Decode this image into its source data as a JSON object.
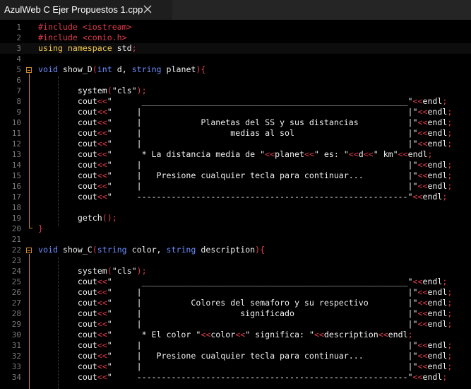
{
  "tab": {
    "title": "AzulWeb C Ejer Propuestos 1.cpp",
    "close_icon": "close-icon"
  },
  "lines": [
    {
      "n": "1",
      "tokens": [
        [
          "k-pp",
          "#include <iostream>"
        ]
      ]
    },
    {
      "n": "2",
      "tokens": [
        [
          "k-pp",
          "#include <conio.h>"
        ]
      ]
    },
    {
      "n": "3",
      "tokens": [
        [
          "k-kw",
          "using namespace"
        ],
        [
          "k-id",
          " std"
        ],
        [
          "k-op",
          ";"
        ]
      ]
    },
    {
      "n": "4",
      "tokens": []
    },
    {
      "n": "5",
      "tokens": [
        [
          "k-type",
          "void"
        ],
        [
          "k-id",
          " show_D"
        ],
        [
          "k-par",
          "("
        ],
        [
          "k-type",
          "int"
        ],
        [
          "k-id",
          " d, "
        ],
        [
          "k-type",
          "string"
        ],
        [
          "k-id",
          " planet"
        ],
        [
          "k-par",
          "){"
        ]
      ]
    },
    {
      "n": "6",
      "tokens": []
    },
    {
      "n": "7",
      "tokens": [
        [
          "k-id",
          "        system"
        ],
        [
          "k-par",
          "("
        ],
        [
          "k-str",
          "\"cls\""
        ],
        [
          "k-par",
          ")"
        ],
        [
          "k-op",
          ";"
        ]
      ]
    },
    {
      "n": "8",
      "tokens": [
        [
          "k-id",
          "        cout"
        ],
        [
          "k-op",
          "<<"
        ],
        [
          "k-str",
          "\"      ______________________________________________________\""
        ],
        [
          "k-op",
          "<<"
        ],
        [
          "k-id",
          "endl"
        ],
        [
          "k-op",
          ";"
        ]
      ]
    },
    {
      "n": "9",
      "tokens": [
        [
          "k-id",
          "        cout"
        ],
        [
          "k-op",
          "<<"
        ],
        [
          "k-str",
          "\"     |                                                      |\""
        ],
        [
          "k-op",
          "<<"
        ],
        [
          "k-id",
          "endl"
        ],
        [
          "k-op",
          ";"
        ]
      ]
    },
    {
      "n": "10",
      "tokens": [
        [
          "k-id",
          "        cout"
        ],
        [
          "k-op",
          "<<"
        ],
        [
          "k-str",
          "\"     |            Planetas del SS y sus distancias          |\""
        ],
        [
          "k-op",
          "<<"
        ],
        [
          "k-id",
          "endl"
        ],
        [
          "k-op",
          ";"
        ]
      ]
    },
    {
      "n": "11",
      "tokens": [
        [
          "k-id",
          "        cout"
        ],
        [
          "k-op",
          "<<"
        ],
        [
          "k-str",
          "\"     |                  medias al sol                       |\""
        ],
        [
          "k-op",
          "<<"
        ],
        [
          "k-id",
          "endl"
        ],
        [
          "k-op",
          ";"
        ]
      ]
    },
    {
      "n": "12",
      "tokens": [
        [
          "k-id",
          "        cout"
        ],
        [
          "k-op",
          "<<"
        ],
        [
          "k-str",
          "\"     |                                                      |\""
        ],
        [
          "k-op",
          "<<"
        ],
        [
          "k-id",
          "endl"
        ],
        [
          "k-op",
          ";"
        ]
      ]
    },
    {
      "n": "13",
      "tokens": [
        [
          "k-id",
          "        cout"
        ],
        [
          "k-op",
          "<<"
        ],
        [
          "k-str",
          "\"      * La distancia media de \""
        ],
        [
          "k-op",
          "<<"
        ],
        [
          "k-id",
          "planet"
        ],
        [
          "k-op",
          "<<"
        ],
        [
          "k-str",
          "\" es: \""
        ],
        [
          "k-op",
          "<<"
        ],
        [
          "k-id",
          "d"
        ],
        [
          "k-op",
          "<<"
        ],
        [
          "k-str",
          "\" km\""
        ],
        [
          "k-op",
          "<<"
        ],
        [
          "k-id",
          "endl"
        ],
        [
          "k-op",
          ";"
        ]
      ]
    },
    {
      "n": "14",
      "tokens": [
        [
          "k-id",
          "        cout"
        ],
        [
          "k-op",
          "<<"
        ],
        [
          "k-str",
          "\"     |                                                      |\""
        ],
        [
          "k-op",
          "<<"
        ],
        [
          "k-id",
          "endl"
        ],
        [
          "k-op",
          ";"
        ]
      ]
    },
    {
      "n": "15",
      "tokens": [
        [
          "k-id",
          "        cout"
        ],
        [
          "k-op",
          "<<"
        ],
        [
          "k-str",
          "\"     |   Presione cualquier tecla para continuar...         |\""
        ],
        [
          "k-op",
          "<<"
        ],
        [
          "k-id",
          "endl"
        ],
        [
          "k-op",
          ";"
        ]
      ]
    },
    {
      "n": "16",
      "tokens": [
        [
          "k-id",
          "        cout"
        ],
        [
          "k-op",
          "<<"
        ],
        [
          "k-str",
          "\"     |                                                      |\""
        ],
        [
          "k-op",
          "<<"
        ],
        [
          "k-id",
          "endl"
        ],
        [
          "k-op",
          ";"
        ]
      ]
    },
    {
      "n": "17",
      "tokens": [
        [
          "k-id",
          "        cout"
        ],
        [
          "k-op",
          "<<"
        ],
        [
          "k-str",
          "\"     -------------------------------------------------------\""
        ],
        [
          "k-op",
          "<<"
        ],
        [
          "k-id",
          "endl"
        ],
        [
          "k-op",
          ";"
        ]
      ]
    },
    {
      "n": "18",
      "tokens": []
    },
    {
      "n": "19",
      "tokens": [
        [
          "k-id",
          "        getch"
        ],
        [
          "k-par",
          "()"
        ],
        [
          "k-op",
          ";"
        ]
      ]
    },
    {
      "n": "20",
      "tokens": [
        [
          "k-par",
          "}"
        ]
      ]
    },
    {
      "n": "21",
      "tokens": []
    },
    {
      "n": "22",
      "tokens": [
        [
          "k-type",
          "void"
        ],
        [
          "k-id",
          " show_C"
        ],
        [
          "k-par",
          "("
        ],
        [
          "k-type",
          "string"
        ],
        [
          "k-id",
          " color, "
        ],
        [
          "k-type",
          "string"
        ],
        [
          "k-id",
          " description"
        ],
        [
          "k-par",
          "){"
        ]
      ]
    },
    {
      "n": "23",
      "tokens": []
    },
    {
      "n": "24",
      "tokens": [
        [
          "k-id",
          "        system"
        ],
        [
          "k-par",
          "("
        ],
        [
          "k-str",
          "\"cls\""
        ],
        [
          "k-par",
          ")"
        ],
        [
          "k-op",
          ";"
        ]
      ]
    },
    {
      "n": "25",
      "tokens": [
        [
          "k-id",
          "        cout"
        ],
        [
          "k-op",
          "<<"
        ],
        [
          "k-str",
          "\"      ______________________________________________________\""
        ],
        [
          "k-op",
          "<<"
        ],
        [
          "k-id",
          "endl"
        ],
        [
          "k-op",
          ";"
        ]
      ]
    },
    {
      "n": "26",
      "tokens": [
        [
          "k-id",
          "        cout"
        ],
        [
          "k-op",
          "<<"
        ],
        [
          "k-str",
          "\"     |                                                      |\""
        ],
        [
          "k-op",
          "<<"
        ],
        [
          "k-id",
          "endl"
        ],
        [
          "k-op",
          ";"
        ]
      ]
    },
    {
      "n": "27",
      "tokens": [
        [
          "k-id",
          "        cout"
        ],
        [
          "k-op",
          "<<"
        ],
        [
          "k-str",
          "\"     |          Colores del semaforo y su respectivo        |\""
        ],
        [
          "k-op",
          "<<"
        ],
        [
          "k-id",
          "endl"
        ],
        [
          "k-op",
          ";"
        ]
      ]
    },
    {
      "n": "28",
      "tokens": [
        [
          "k-id",
          "        cout"
        ],
        [
          "k-op",
          "<<"
        ],
        [
          "k-str",
          "\"     |                    significado                       |\""
        ],
        [
          "k-op",
          "<<"
        ],
        [
          "k-id",
          "endl"
        ],
        [
          "k-op",
          ";"
        ]
      ]
    },
    {
      "n": "29",
      "tokens": [
        [
          "k-id",
          "        cout"
        ],
        [
          "k-op",
          "<<"
        ],
        [
          "k-str",
          "\"     |                                                      |\""
        ],
        [
          "k-op",
          "<<"
        ],
        [
          "k-id",
          "endl"
        ],
        [
          "k-op",
          ";"
        ]
      ]
    },
    {
      "n": "30",
      "tokens": [
        [
          "k-id",
          "        cout"
        ],
        [
          "k-op",
          "<<"
        ],
        [
          "k-str",
          "\"      * El color \""
        ],
        [
          "k-op",
          "<<"
        ],
        [
          "k-id",
          "color"
        ],
        [
          "k-op",
          "<<"
        ],
        [
          "k-str",
          "\" significa: \""
        ],
        [
          "k-op",
          "<<"
        ],
        [
          "k-id",
          "description"
        ],
        [
          "k-op",
          "<<"
        ],
        [
          "k-id",
          "endl"
        ],
        [
          "k-op",
          ";"
        ]
      ]
    },
    {
      "n": "31",
      "tokens": [
        [
          "k-id",
          "        cout"
        ],
        [
          "k-op",
          "<<"
        ],
        [
          "k-str",
          "\"     |                                                      |\""
        ],
        [
          "k-op",
          "<<"
        ],
        [
          "k-id",
          "endl"
        ],
        [
          "k-op",
          ";"
        ]
      ]
    },
    {
      "n": "32",
      "tokens": [
        [
          "k-id",
          "        cout"
        ],
        [
          "k-op",
          "<<"
        ],
        [
          "k-str",
          "\"     |   Presione cualquier tecla para continuar...         |\""
        ],
        [
          "k-op",
          "<<"
        ],
        [
          "k-id",
          "endl"
        ],
        [
          "k-op",
          ";"
        ]
      ]
    },
    {
      "n": "33",
      "tokens": [
        [
          "k-id",
          "        cout"
        ],
        [
          "k-op",
          "<<"
        ],
        [
          "k-str",
          "\"     |                                                      |\""
        ],
        [
          "k-op",
          "<<"
        ],
        [
          "k-id",
          "endl"
        ],
        [
          "k-op",
          ";"
        ]
      ]
    },
    {
      "n": "34",
      "tokens": [
        [
          "k-id",
          "        cout"
        ],
        [
          "k-op",
          "<<"
        ],
        [
          "k-str",
          "\"     -------------------------------------------------------\""
        ],
        [
          "k-op",
          "<<"
        ],
        [
          "k-id",
          "endl"
        ],
        [
          "k-op",
          ";"
        ]
      ]
    }
  ],
  "colors": {
    "background": "#000000",
    "preprocessor": "#e03c4b",
    "type": "#6b8cff",
    "keyword": "#f2c94c",
    "fold_marker": "#d08a2e",
    "line_number": "#7a7a7a"
  }
}
